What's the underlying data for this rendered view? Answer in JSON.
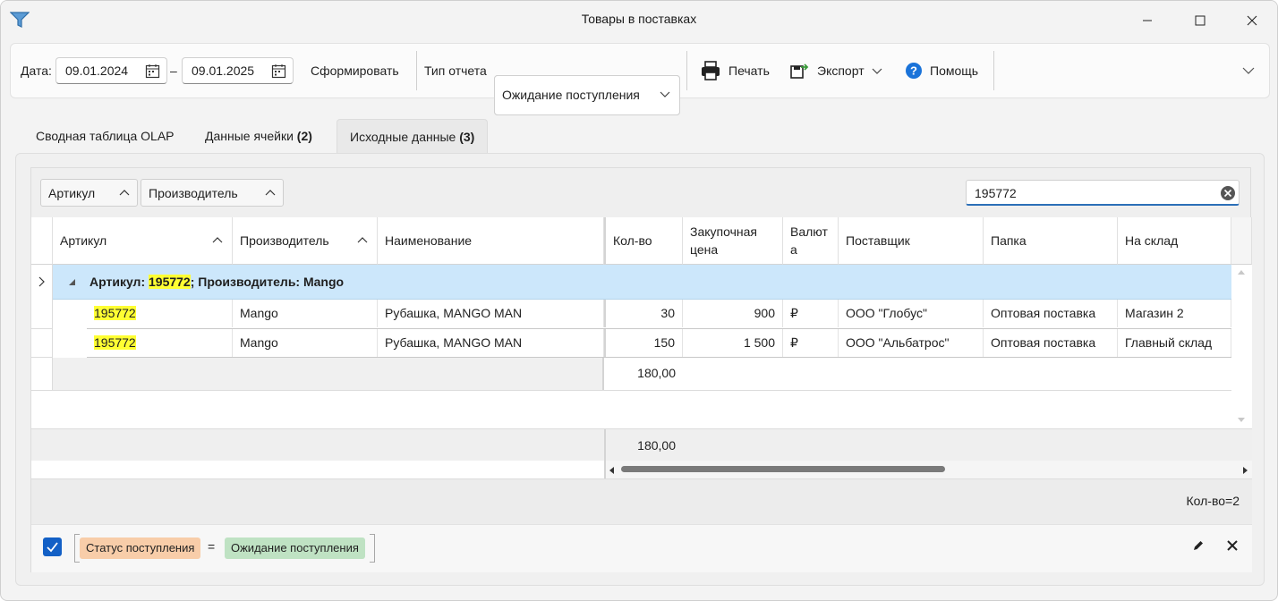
{
  "window": {
    "title": "Товары в поставках"
  },
  "toolbar": {
    "date_label": "Дата:",
    "date_from": "09.01.2024",
    "dash": "–",
    "date_to": "09.01.2025",
    "generate": "Сформировать",
    "report_type_label": "Тип отчета",
    "report_type_value": "Ожидание поступления",
    "print": "Печать",
    "export": "Экспорт",
    "help": "Помощь"
  },
  "tabs": [
    {
      "label": "Сводная таблица OLAP",
      "count": ""
    },
    {
      "label": "Данные ячейки ",
      "count": "(2)"
    },
    {
      "label": "Исходные данные ",
      "count": "(3)"
    }
  ],
  "grouping": {
    "chips": [
      "Артикул",
      "Производитель"
    ]
  },
  "search": {
    "value": "195772"
  },
  "grid": {
    "columns": [
      "Артикул",
      "Производитель",
      "Наименование",
      "Кол-во",
      "Закупочная цена",
      "Валют а",
      "Поставщик",
      "Папка",
      "На склад"
    ],
    "group_row": {
      "prefix": "Артикул: ",
      "key": "195772",
      "suffix": "; Производитель: Mango"
    },
    "rows": [
      [
        "195772",
        "Mango",
        "Рубашка, MANGO MAN",
        "30",
        "900",
        "₽",
        "ООО \"Глобус\"",
        "Оптовая поставка",
        "Магазин 2"
      ],
      [
        "195772",
        "Mango",
        "Рубашка, MANGO MAN",
        "150",
        "1 500",
        "₽",
        "ООО \"Альбатрос\"",
        "Оптовая поставка",
        "Главный склад"
      ]
    ],
    "group_total": "180,00",
    "grand_total": "180,00"
  },
  "status": {
    "count": "Кол-во=2"
  },
  "filter": {
    "field": "Статус поступления",
    "op": "=",
    "value": "Ожидание поступления"
  },
  "colors": {
    "accent": "#1360c6",
    "group_row": "#cce7fb",
    "highlight": "#ffff33",
    "field_tag": "#f8cda9",
    "value_tag": "#bfe2c3"
  }
}
